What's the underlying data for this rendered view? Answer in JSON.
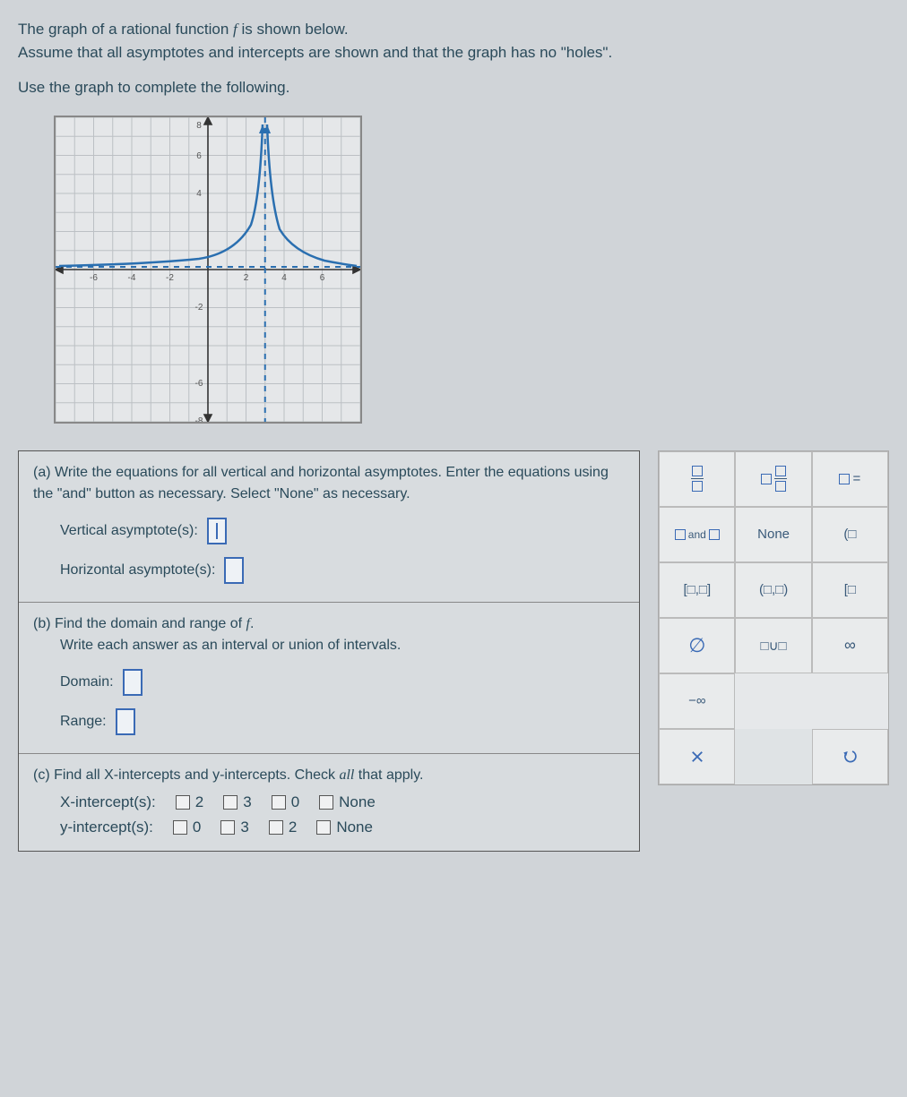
{
  "intro": {
    "line1_a": "The graph of a rational function ",
    "line1_f": "f",
    "line1_b": " is shown below.",
    "line2": "Assume that all asymptotes and intercepts are shown and that the graph has no \"holes\".",
    "line3": "Use the graph to complete the following."
  },
  "parts": {
    "a": {
      "label": "(a)",
      "text": "Write the equations for all vertical and horizontal asymptotes. Enter the equations using the \"and\" button as necessary. Select \"None\" as necessary.",
      "vertical_label": "Vertical asymptote(s):",
      "horizontal_label": "Horizontal asymptote(s):"
    },
    "b": {
      "label": "(b)",
      "text_a": "Find the domain and range of ",
      "text_f": "f",
      "text_b": ".",
      "sub": "Write each answer as an interval or union of intervals.",
      "domain_label": "Domain:",
      "range_label": "Range:"
    },
    "c": {
      "label": "(c)",
      "text_a": "Find all X-intercepts and y-intercepts. Check ",
      "text_i": "all",
      "text_b": " that apply.",
      "xint_label": "X-intercept(s):",
      "yint_label": "y-intercept(s):",
      "x_options": [
        "2",
        "3",
        "0",
        "None"
      ],
      "y_options": [
        "0",
        "3",
        "2",
        "None"
      ]
    }
  },
  "palette": {
    "and": "and",
    "none": "None",
    "interval_closed": "[□,□]",
    "interval_open": "(□,□)",
    "interval_mixed": "[□",
    "union": "□∪□",
    "neg_inf": "−∞",
    "paren": "(□",
    "eq": "□="
  },
  "chart_data": {
    "type": "line",
    "title": "",
    "xlabel": "",
    "ylabel": "",
    "xlim": [
      -8,
      8
    ],
    "ylim": [
      -8,
      8
    ],
    "grid": true,
    "asymptotes": {
      "vertical": [
        3
      ],
      "horizontal": [
        0
      ]
    },
    "series": [
      {
        "name": "left-branch",
        "x": [
          -8,
          -6,
          -4,
          -2,
          0,
          1,
          2,
          2.5,
          2.8
        ],
        "y": [
          0.1,
          0.12,
          0.15,
          0.2,
          0.35,
          0.6,
          1.2,
          3,
          8
        ]
      },
      {
        "name": "right-branch",
        "x": [
          3.2,
          3.5,
          4,
          5,
          6,
          7,
          8
        ],
        "y": [
          8,
          3,
          1.2,
          0.6,
          0.35,
          0.25,
          0.2
        ]
      }
    ]
  }
}
